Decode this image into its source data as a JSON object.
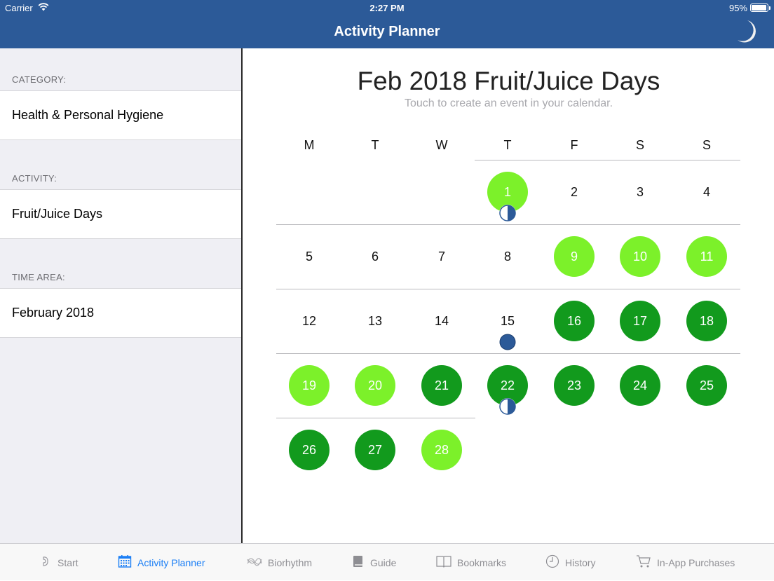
{
  "status": {
    "carrier": "Carrier",
    "time": "2:27 PM",
    "battery": "95%"
  },
  "nav": {
    "title": "Activity Planner"
  },
  "sidebar": {
    "sections": [
      {
        "header": "CATEGORY:",
        "value": "Health & Personal Hygiene"
      },
      {
        "header": "ACTIVITY:",
        "value": "Fruit/Juice Days"
      },
      {
        "header": "TIME AREA:",
        "value": "February 2018"
      }
    ]
  },
  "calendar": {
    "title": "Feb 2018  Fruit/Juice Days",
    "subtitle": "Touch to create an event in your calendar.",
    "weekdays": [
      "M",
      "T",
      "W",
      "T",
      "F",
      "S",
      "S"
    ],
    "first_weekday_index": 3,
    "days_in_month": 28,
    "light_green_days": [
      1,
      9,
      10,
      11,
      19,
      20,
      28
    ],
    "dark_green_days": [
      16,
      17,
      18,
      21,
      22,
      23,
      24,
      25,
      26,
      27
    ],
    "moon_markers": [
      {
        "day": 1,
        "phase": "half-moon-icon"
      },
      {
        "day": 15,
        "phase": "full-moon-icon"
      },
      {
        "day": 22,
        "phase": "half-moon-icon"
      }
    ],
    "colors": {
      "light_green": "#7cf12a",
      "dark_green": "#129a1d",
      "moon_blue": "#2c5a98"
    }
  },
  "tabs": [
    {
      "label": "Start",
      "icon": "start-icon",
      "active": false
    },
    {
      "label": "Activity Planner",
      "icon": "calendar-icon",
      "active": true
    },
    {
      "label": "Biorhythm",
      "icon": "biorhythm-icon",
      "active": false
    },
    {
      "label": "Guide",
      "icon": "book-icon",
      "active": false
    },
    {
      "label": "Bookmarks",
      "icon": "bookmarks-icon",
      "active": false
    },
    {
      "label": "History",
      "icon": "clock-icon",
      "active": false
    },
    {
      "label": "In-App Purchases",
      "icon": "cart-icon",
      "active": false
    }
  ]
}
